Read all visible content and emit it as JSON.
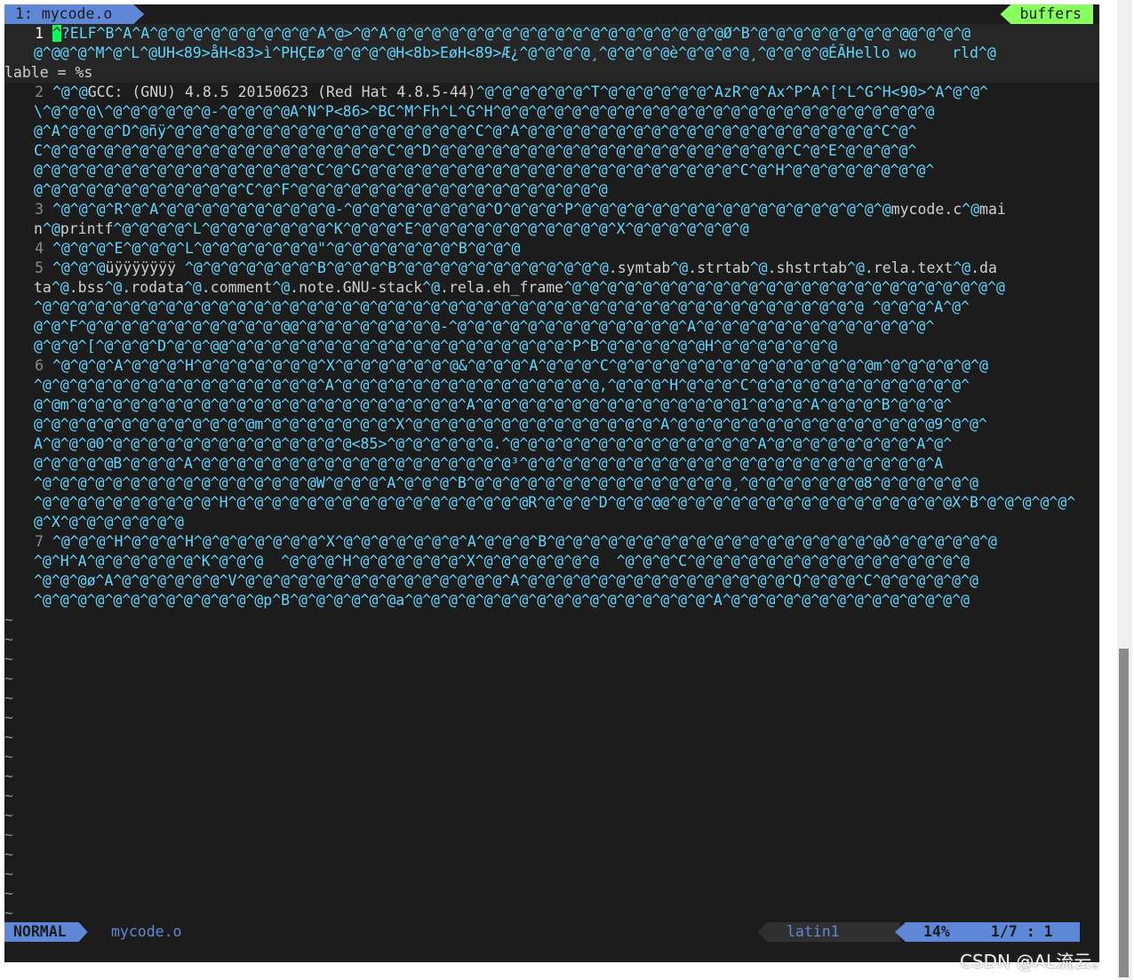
{
  "tabline": {
    "active_tab": "1: mycode.o",
    "buffers_label": "buffers"
  },
  "lines": [
    {
      "num": "1",
      "rows": [
        [
          [
            "c",
            "^"
          ],
          [
            "t",
            "?ELF^B^A^A^@^@^@^@^@^@^@^@^@^A^@>^@^A^@^@^@^@^@^@^@^@^@^@^@^@^@^@^@^@^@^@^@Ø^B^@^@^@^@^@^@^@^@^@@^@^@^@"
          ]
        ],
        [
          [
            "t",
            "@^@@^@^M^@^L^@UH<89>åH<83>ì^PHÇEø^@^@^@^@H<8b>EøH<89>Æ¿^@^@^@^@¸^@^@^@^@è^@^@^@^@¸^@^@^@^@ÉÃHello wo    rld^@"
          ]
        ],
        [
          [
            "w",
            "lable = %s"
          ]
        ]
      ]
    },
    {
      "num": "2",
      "rows": [
        [
          [
            "t",
            "^@^@"
          ],
          [
            "w",
            "GCC: (GNU) 4.8.5 20150623 (Red Hat 4.8.5-44)"
          ],
          [
            "t",
            "^@^@^@^@^@^@^T^@^@^@^@^@^@^AzR^@^Ax^P^A^[^L^G^H<90>^A^@^@^"
          ]
        ],
        [
          [
            "t",
            "\\^@^@^@\\^@^@^@^@^@^@-^@^@^@^@A^N^P<86>^BC^M^Fh^L^G^H^@^@^@^@^@^@^@^@^@^@^@^@^@^@^@^@^@^@^@^@^@^@^@^@^@"
          ]
        ],
        [
          [
            "t",
            "@^A^@^@^@^D^@ñÿ^@^@^@^@^@^@^@^@^@^@^@^@^@^@^@^@^@^C^@^A^@^@^@^@^@^@^@^@^@^@^@^@^@^@^@^@^@^@^@^@^C^@^"
          ]
        ],
        [
          [
            "t",
            "C^@^@^@^@^@^@^@^@^@^@^@^@^@^@^@^@^@^@^@^C^@^D^@^@^@^@^@^@^@^@^@^@^@^@^@^@^@^@^@^@^@^@^C^@^E^@^@^@^@^"
          ]
        ],
        [
          [
            "t",
            "@^@^@^@^@^@^@^@^@^@^@^@^@^@^@^@^C^@^G^@^@^@^@^@^@^@^@^@^@^@^@^@^@^@^@^@^@^@^@^@^C^@^H^@^@^@^@^@^@^@^@^"
          ]
        ],
        [
          [
            "t",
            "@^@^@^@^@^@^@^@^@^@^@^@^C^@^F^@^@^@^@^@^@^@^@^@^@^@^@^@^@^@^@^@^@"
          ]
        ]
      ]
    },
    {
      "num": "3",
      "rows": [
        [
          [
            "t",
            "^@^@^@^R^@^A^@^@^@^@^@^@^@^@^@^@-^@^@^@^@^@^@^@^@^O^@^@^@^P^@^@^@^@^@^@^@^@^@^@^@^@^@^@^@^@^@^@"
          ],
          [
            "w",
            "mycode.c"
          ],
          [
            "t",
            "^@"
          ],
          [
            "w",
            "mai"
          ]
        ],
        [
          [
            "w",
            "n"
          ],
          [
            "t",
            "^@"
          ],
          [
            "w",
            "printf"
          ],
          [
            "t",
            "^@^@^@^@^L^@^@^@^@^@^@^@^K^@^@^@^E^@^@^@^@^@^@^@^@^@^@^@^X^@^@^@^@^@^@^@"
          ]
        ]
      ]
    },
    {
      "num": "4",
      "rows": [
        [
          [
            "t",
            "^@^@^@^E^@^@^@^L^@^@^@^@^@^@^@\"^@^@^@^@^@^@^@^B^@^@^@"
          ]
        ]
      ]
    },
    {
      "num": "5",
      "rows": [
        [
          [
            "t",
            "^@^@^@"
          ],
          [
            "w",
            "üÿÿÿÿÿÿÿ "
          ],
          [
            "t",
            "^@^@^@^@^@^@^@^B^@^@^@^B^@^@^@^@^@^@^@^@^@^@^@^@"
          ],
          [
            "w",
            ".symtab"
          ],
          [
            "t",
            "^@"
          ],
          [
            "w",
            ".strtab"
          ],
          [
            "t",
            "^@"
          ],
          [
            "w",
            ".shstrtab"
          ],
          [
            "t",
            "^@"
          ],
          [
            "w",
            ".rela.text"
          ],
          [
            "t",
            "^@"
          ],
          [
            "w",
            ".da"
          ]
        ],
        [
          [
            "w",
            "ta"
          ],
          [
            "t",
            "^@"
          ],
          [
            "w",
            ".bss"
          ],
          [
            "t",
            "^@"
          ],
          [
            "w",
            ".rodata"
          ],
          [
            "t",
            "^@"
          ],
          [
            "w",
            ".comment"
          ],
          [
            "t",
            "^@"
          ],
          [
            "w",
            ".note.GNU-stack"
          ],
          [
            "t",
            "^@"
          ],
          [
            "w",
            ".rela.eh_frame"
          ],
          [
            "t",
            "^@^@^@^@^@^@^@^@^@^@^@^@^@^@^@^@^@^@^@^@^@^@^@^@^@"
          ]
        ],
        [
          [
            "t",
            "^@^@^@^@^@^@^@^@^@^@^@^@^@^@^@^@^@^@^@^@^@^@^@^@^@^@^@^@^@^@^@^@^@^@^@^@^@^@^@^@^@^@^@^@^@^@^@ ^@^@^@^A^@^"
          ]
        ],
        [
          [
            "t",
            "@^@^F^@^@^@^@^@^@^@^@^@^@^@^@@^@^@^@^@^@^@^@^@-^@^@^@^@^@^@^@^@^@^@^@^@^@^A^@^@^@^@^@^@^@^@^@^@^@^@^@^"
          ]
        ],
        [
          [
            "t",
            "@^@^@^[^@^@^@^D^@^@^@@^@^@^@^@^@^@^@^@^@^@^@^@^@^@^@^@^@^@^@^P^B^@^@^@^@^@^@H^@^@^@^@^@^@^@"
          ]
        ]
      ]
    },
    {
      "num": "6",
      "rows": [
        [
          [
            "t",
            "^@^@^@^A^@^@^@^H^@^@^@^@^@^@^@^X^@^@^@^@^@^@^@&^@^@^@^A^@^@^@^C^@^@^@^@^@^@^@^@^@^@^@^@^@^@^@m^@^@^@^@^@^@"
          ]
        ],
        [
          [
            "t",
            "^@^@^@^@^@^@^@^@^@^@^@^@^@^@^@^@^A^@^@^@^@^@^@^@^@^@^@^@^@^@^@^@,^@^@^@^H^@^@^@^C^@^@^@^@^@^@^@^@^@^@^@^@^"
          ]
        ],
        [
          [
            "t",
            "@^@m^@^@^@^@^@^@^@^@^@^@^@^@^@^@^@^@^@^@^@^@^@^@^A^@^@^@^@^@^@^@^@^@^@^@^@^@^@^@1^@^@^@^A^@^@^@^B^@^@^@^"
          ]
        ],
        [
          [
            "t",
            "@^@^@^@^@^@^@^@^@^@^@^@^@m^@^@^@^@^@^@^@^X^@^@^@^@^@^@^@^@^@^@^@^@^@^@^A^@^@^@^@^@^@^@^@^@^@^@^@^@^@^@9^@^@^"
          ]
        ],
        [
          [
            "t",
            "A^@^@^@0^@^@^@^@^@^@^@^@^@^@^@^@^@^@<85>^@^@^@^@^@^@.^@^@^@^@^@^@^@^@^@^@^@^@^@^@^A^@^@^@^@^@^@^@^@^A^@^"
          ]
        ],
        [
          [
            "t",
            "@^@^@^@^@B^@^@^@^A^@^@^@^@^@^@^@^@^@^@^@^@^@^@^@^@^@^@³^@^@^@^@^@^@^@^@^@^@^@^@^@^@^@^@^@^@^@^@^@^@^@^A"
          ]
        ],
        [
          [
            "t",
            "^@^@^@^@^@^@^@^@^@^@^@^@^@^@^@^@W^@^@^@^A^@^@^@^B^@^@^@^@^@^@^@^@^@^@^@^@^@^@^@¸^@^@^@^@^@^@^@8^@^@^@^@^@^@"
          ]
        ],
        [
          [
            "t",
            "^@^@^@^@^@^@^@^@^@^@^H^@^@^@^@^@^@^@^@^@^@^@^@^@^@^@^@^@R^@^@^@^D^@^@^@@^@^@^@^@^@^@^@^@^@^@^@^@^@^@^@^@X^B^@^@^@^@^@^"
          ]
        ],
        [
          [
            "t",
            "@^X^@^@^@^@^@^@^@"
          ]
        ]
      ]
    },
    {
      "num": "7",
      "rows": [
        [
          [
            "t",
            "^@^@^@^H^@^@^@^H^@^@^@^@^@^@^@^X^@^@^@^@^@^@^@^A^@^@^@^B^@^@^@^@^@^@^@^@^@^@^@^@^@^@^@^@^@^@^@ð^@^@^@^@^@^@"
          ]
        ],
        [
          [
            "t",
            "^@^H^A^@^@^@^@^@^@^K^@^@^@  ^@^@^@^H^@^@^@^@^@^@^X^@^@^@^@^@^@^@  ^@^@^@^C^@^@^@^@^@^@^@^@^@^@^@^@^@^@^@^@"
          ]
        ],
        [
          [
            "t",
            "^@^@^@ø^A^@^@^@^@^@^@^V^@^@^@^@^@^@^@^@^@^@^@^@^@^@^@^A^@^@^@^@^@^@^@^@^@^@^@^@^@^@^@^Q^@^@^@^C^@^@^@^@^@^@"
          ]
        ],
        [
          [
            "t",
            "^@^@^@^@^@^@^@^@^@^@^@^@^@p^B^@^@^@^@^@^@a^@^@^@^@^@^@^@^@^@^@^@^@^@^@^@^@^@^A^@^@^@^@^@^@^@^@^@^@^@^@^@^@"
          ]
        ]
      ]
    }
  ],
  "tilde_count": 16,
  "tilde_char": "~",
  "statusline": {
    "mode": "NORMAL",
    "filename": "mycode.o",
    "encoding": "latin1",
    "percent": "14%",
    "position": "1/7 :  1"
  },
  "watermark": "CSDN @AL流云。",
  "colors": {
    "background": "#1c1c1c",
    "special_chars": "#5fd7ff",
    "text": "#d0d0d0",
    "accent_blue": "#5f87d7",
    "buffers_green": "#87ff5f",
    "cursor": "#00ff5f"
  }
}
